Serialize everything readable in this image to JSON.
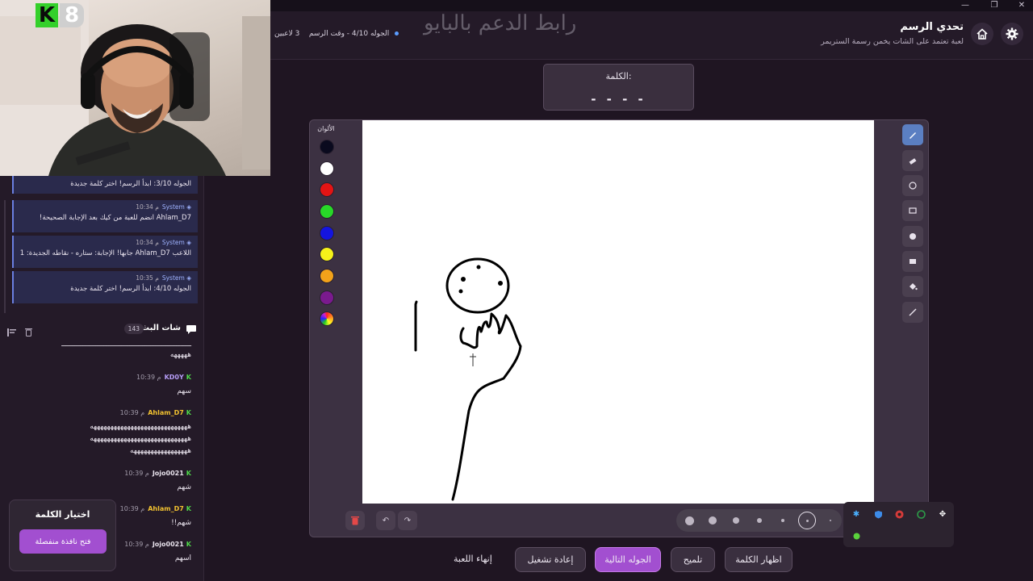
{
  "window": {
    "min": "—",
    "restore": "❐",
    "close": "✕"
  },
  "header": {
    "title": "تحدي الرسم",
    "subtitle": "لعبة تعتمد على الشات يخمن رسمة الستريمر",
    "players": "3 لاعبين",
    "round_info": "الجوله 4/10 - وقت الرسم",
    "watermark": "رابط الدعم بالبايو"
  },
  "word": {
    "label": "الكلمة:",
    "blanks": "- - - -"
  },
  "palette": {
    "title": "الألوان",
    "colors": [
      "#0a0a1e",
      "#ffffff",
      "#e31414",
      "#28d828",
      "#1414e0",
      "#f6f21a",
      "#f2a21a",
      "#7a1a8e"
    ]
  },
  "tools": [
    "pencil-icon",
    "eraser-icon",
    "circle-icon",
    "rectangle-icon",
    "filled-circle-icon",
    "filled-rectangle-icon",
    "fill-bucket-icon",
    "line-icon"
  ],
  "brush_sizes": {
    "selected_index": 5
  },
  "actions": {
    "show_word": "اظهار الكلمة",
    "hint": "تلميح",
    "next_round": "الجوله التالية",
    "restart": "إعادة تشغيل",
    "end_game": "إنهاء اللعبة"
  },
  "stream": {
    "logo_k": "K",
    "logo_8": "8"
  },
  "system_messages": [
    {
      "sender": "",
      "time": "",
      "text": "الجوله 3/10: ابدأ الرسم! اختر كلمة جديدة"
    },
    {
      "sender": "System",
      "time": "10:34 م",
      "text": "Ahlam_D7 انضم للعبة من كيك بعد الإجابة الصحيحة!"
    },
    {
      "sender": "System",
      "time": "10:34 م",
      "text": "اللاعب Ahlam_D7 جابها! الإجابة: ستاره - نقاطه الجديدة: 1"
    },
    {
      "sender": "System",
      "time": "10:35 م",
      "text": "الجوله 4/10: ابدأ الرسم! اختر كلمة جديدة"
    }
  ],
  "chat": {
    "title": "شات البث",
    "count": "143",
    "messages": [
      {
        "user": "",
        "time": "",
        "lines": [
          "ـــــــــــــــــــــــــــــــــــــــــــــــــــــــــــــ",
          "هههههه"
        ]
      },
      {
        "user": "KD0Y",
        "time": "10:39 م",
        "color": "#b59cf5",
        "lines": [
          "سهم"
        ]
      },
      {
        "user": "Ahlam_D7",
        "time": "10:39 م",
        "color": "#f2c230",
        "lines": [
          "هههههههههههههههههههههههههههههه",
          "هههههههههههههههههههههههههههههه",
          "هههههههههههههههههه"
        ]
      },
      {
        "user": "Jojo0021",
        "time": "10:39 م",
        "color": "#e6e0ea",
        "lines": [
          "شهم"
        ]
      },
      {
        "user": "Ahlam_D7",
        "time": "10:39 م",
        "color": "#f2c230",
        "lines": [
          "شهم!!"
        ]
      },
      {
        "user": "Jojo0021",
        "time": "10:39 م",
        "color": "#e6e0ea",
        "lines": [
          "اسهم"
        ]
      }
    ]
  },
  "word_picker": {
    "title": "اختيار الكلمة",
    "button": "فتح نافذة منفصلة"
  }
}
